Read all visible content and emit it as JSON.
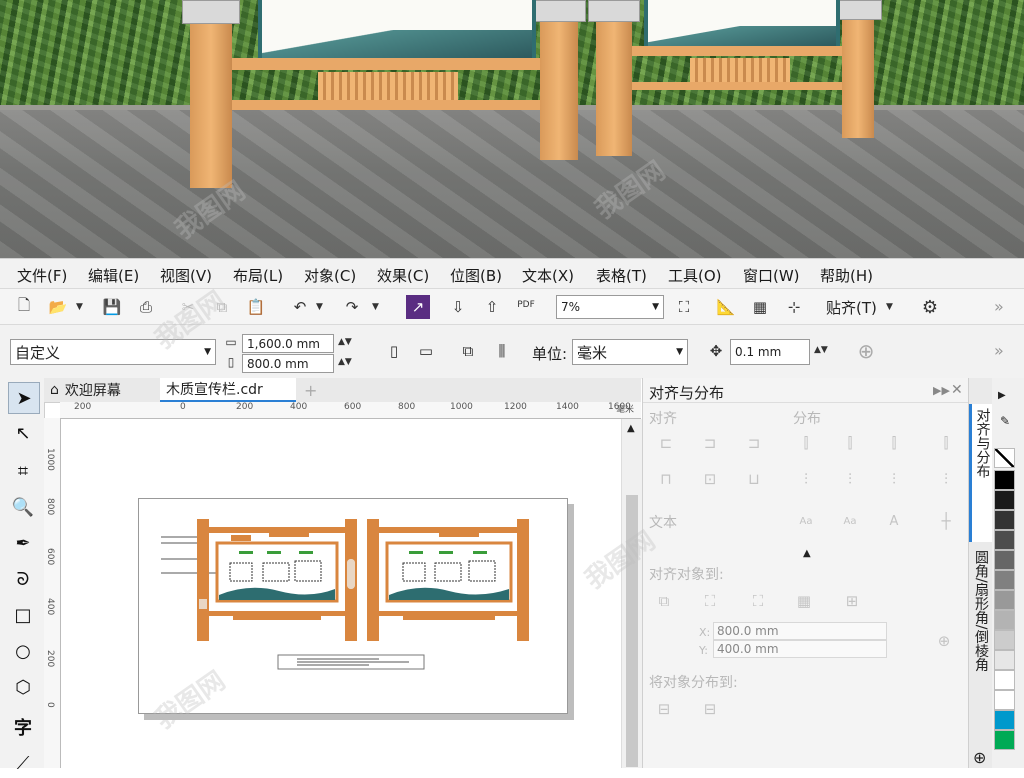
{
  "menu": [
    "文件(F)",
    "编辑(E)",
    "视图(V)",
    "布局(L)",
    "对象(C)",
    "效果(C)",
    "位图(B)",
    "文本(X)",
    "表格(T)",
    "工具(O)",
    "窗口(W)",
    "帮助(H)"
  ],
  "standard_toolbar": {
    "zoom": "7%",
    "snap_label": "贴齐(T)",
    "pdf_label": "PDF",
    "more": "»"
  },
  "property_bar": {
    "page_preset": "自定义",
    "width": "1,600.0 mm",
    "height": "800.0 mm",
    "unit_label": "单位:",
    "unit": "毫米",
    "nudge": "0.1 mm",
    "more": "»"
  },
  "doc_tabs": [
    {
      "label": "欢迎屏幕",
      "icon": "home-icon"
    },
    {
      "label": "木质宣传栏.cdr"
    }
  ],
  "ruler": {
    "h_ticks": [
      "200",
      "0",
      "200",
      "400",
      "600",
      "800",
      "1000",
      "1200",
      "1400",
      "1600"
    ],
    "unit": "毫米",
    "v_ticks": [
      "1000",
      "800",
      "600",
      "400",
      "200",
      "0"
    ]
  },
  "docker": {
    "title": "对齐与分布",
    "align_section": "对齐",
    "distribute_section": "分布",
    "text_section": "文本",
    "align_to_section": "对齐对象到:",
    "x_label": "X:",
    "x_value": "800.0 mm",
    "y_label": "Y:",
    "y_value": "400.0 mm",
    "distribute_to_section": "将对象分布到:"
  },
  "vertical_tabs": [
    "对齐与分布",
    "圆角/扇形角/倒棱角"
  ],
  "palette": [
    "#ffffff",
    "#000000",
    "#1a1a1a",
    "#333333",
    "#4d4d4d",
    "#666666",
    "#808080",
    "#999999",
    "#b3b3b3",
    "#cccccc",
    "#e6e6e6",
    "#ffffff",
    "#ffffff",
    "#0099cc",
    "#00aa55"
  ],
  "watermark": "我图网",
  "colors": {
    "accent": "#2a7fd4",
    "wood": "#d9863f"
  }
}
